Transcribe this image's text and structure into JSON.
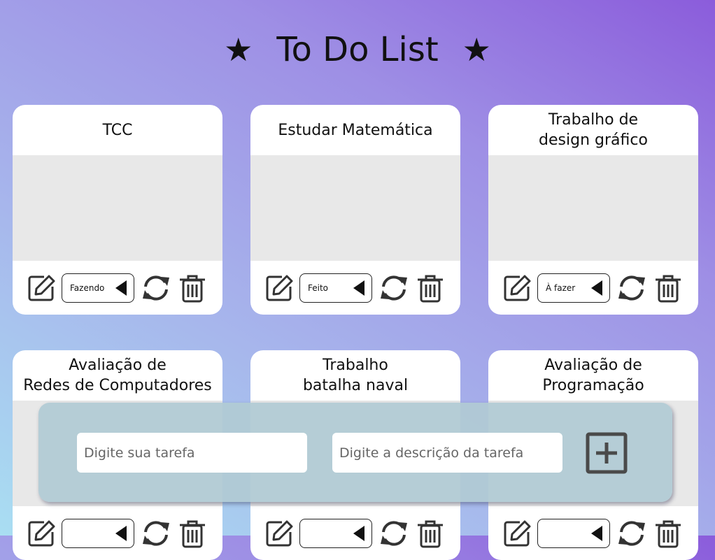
{
  "app": {
    "title": "To Do List",
    "star_left": "★",
    "star_right": "★"
  },
  "cards": [
    {
      "title": "TCC",
      "status": "Fazendo"
    },
    {
      "title": "Estudar Matemática",
      "status": "Feito"
    },
    {
      "title": "Trabalho de\ndesign gráfico",
      "status": "À fazer"
    },
    {
      "title": "Avaliação de\nRedes de Computadores",
      "status": ""
    },
    {
      "title": "Trabalho\nbatalha naval",
      "status": ""
    },
    {
      "title": "Avaliação de\nProgramação",
      "status": ""
    }
  ],
  "form": {
    "task_placeholder": "Digite sua tarefa",
    "description_placeholder": "Digite a descrição da tarefa",
    "add_icon": "plus-square-icon"
  },
  "icons": {
    "edit": "edit-icon",
    "status_caret": "caret-left-icon",
    "refresh": "refresh-icon",
    "delete": "trash-icon"
  },
  "colors": {
    "card_background": "#ffffff",
    "card_body": "#e8e8e8",
    "panel": "#b0cad4",
    "gradient_start": "#a9def2",
    "gradient_end": "#8b5cdb"
  }
}
